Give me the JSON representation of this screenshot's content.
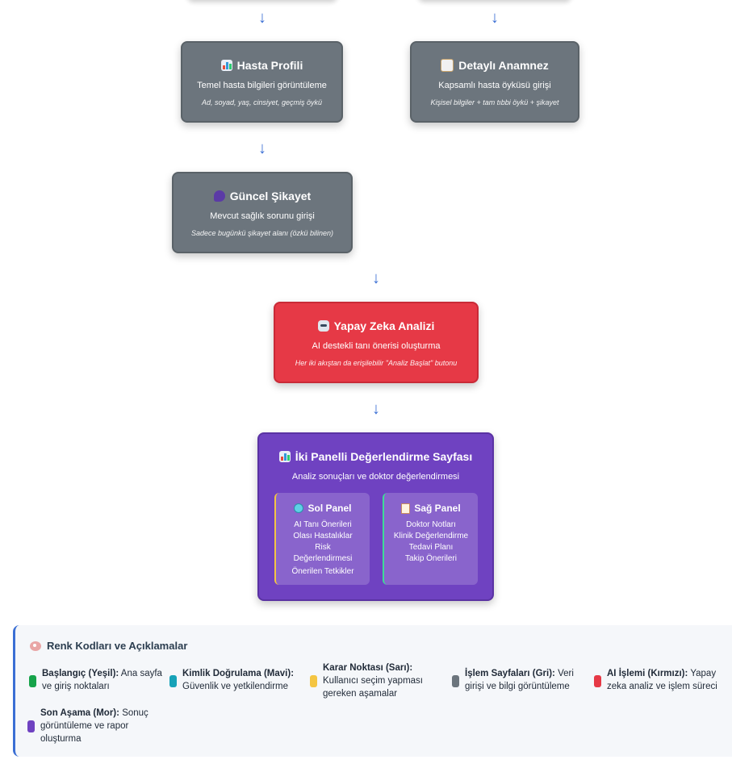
{
  "arrow_glyph": "↓",
  "nodes": {
    "hasta_profili": {
      "title": "Hasta Profili",
      "subtitle": "Temel hasta bilgileri görüntüleme",
      "note": "Ad, soyad, yaş, cinsiyet, geçmiş öykü",
      "icon": "bar-chart-icon"
    },
    "detayli_anamnez": {
      "title": "Detaylı Anamnez",
      "subtitle": "Kapsamlı hasta öyküsü girişi",
      "note": "Kişisel bilgiler + tam tıbbi öykü + şikayet",
      "icon": "clipboard-icon"
    },
    "guncel_sikayet": {
      "title": "Güncel Şikayet",
      "subtitle": "Mevcut sağlık sorunu girişi",
      "note": "Sadece bugünkü şikayet alanı (özkü bilinen)",
      "icon": "speech-icon"
    },
    "yapay_zeka": {
      "title": "Yapay Zeka Analizi",
      "subtitle": "AI destekli tanı önerisi oluşturma",
      "note": "Her iki akıştan da erişilebilir \"Analiz Başlat\" butonu",
      "icon": "robot-icon"
    },
    "iki_panelli": {
      "title": "İki Panelli Değerlendirme Sayfası",
      "subtitle": "Analiz sonuçları ve doktor değerlendirmesi",
      "icon": "bar-chart-icon",
      "sol_panel": {
        "title": "Sol Panel",
        "icon": "magnifier-icon",
        "items": [
          "AI Tanı Önerileri",
          "Olası Hastalıklar",
          "Risk",
          "Değerlendirmesi",
          "Önerilen Tetkikler"
        ]
      },
      "sag_panel": {
        "title": "Sağ Panel",
        "icon": "memo-icon",
        "items": [
          "Doktor Notları",
          "Klinik Değerlendirme",
          "Tedavi Planı",
          "Takip Önerileri"
        ]
      }
    }
  },
  "legend": {
    "title": "Renk Kodları ve Açıklamalar",
    "icon": "palette-icon",
    "items": [
      {
        "label": "Başlangıç (Yeşil):",
        "desc": "Ana sayfa ve giriş noktaları",
        "color": "#16a34a"
      },
      {
        "label": "Kimlik Doğrulama (Mavi):",
        "desc": "Güvenlik ve yetkilendirme",
        "color": "#17a2b8"
      },
      {
        "label": "Karar Noktası (Sarı):",
        "desc": "Kullanıcı seçim yapması gereken aşamalar",
        "color": "#f4c542"
      },
      {
        "label": "İşlem Sayfaları (Gri):",
        "desc": "Veri girişi ve bilgi görüntüleme",
        "color": "#6c757d"
      },
      {
        "label": "AI İşlemi (Kırmızı):",
        "desc": "Yapay zeka analiz ve işlem süreci",
        "color": "#e63946"
      },
      {
        "label": "Son Aşama (Mor):",
        "desc": "Sonuç görüntüleme ve rapor oluşturma",
        "color": "#6f42c1"
      }
    ]
  },
  "colors": {
    "gray_node": "#6c757d",
    "red_node": "#e63946",
    "purple_node": "#6f42c1",
    "arrow": "#3b6fd4"
  }
}
